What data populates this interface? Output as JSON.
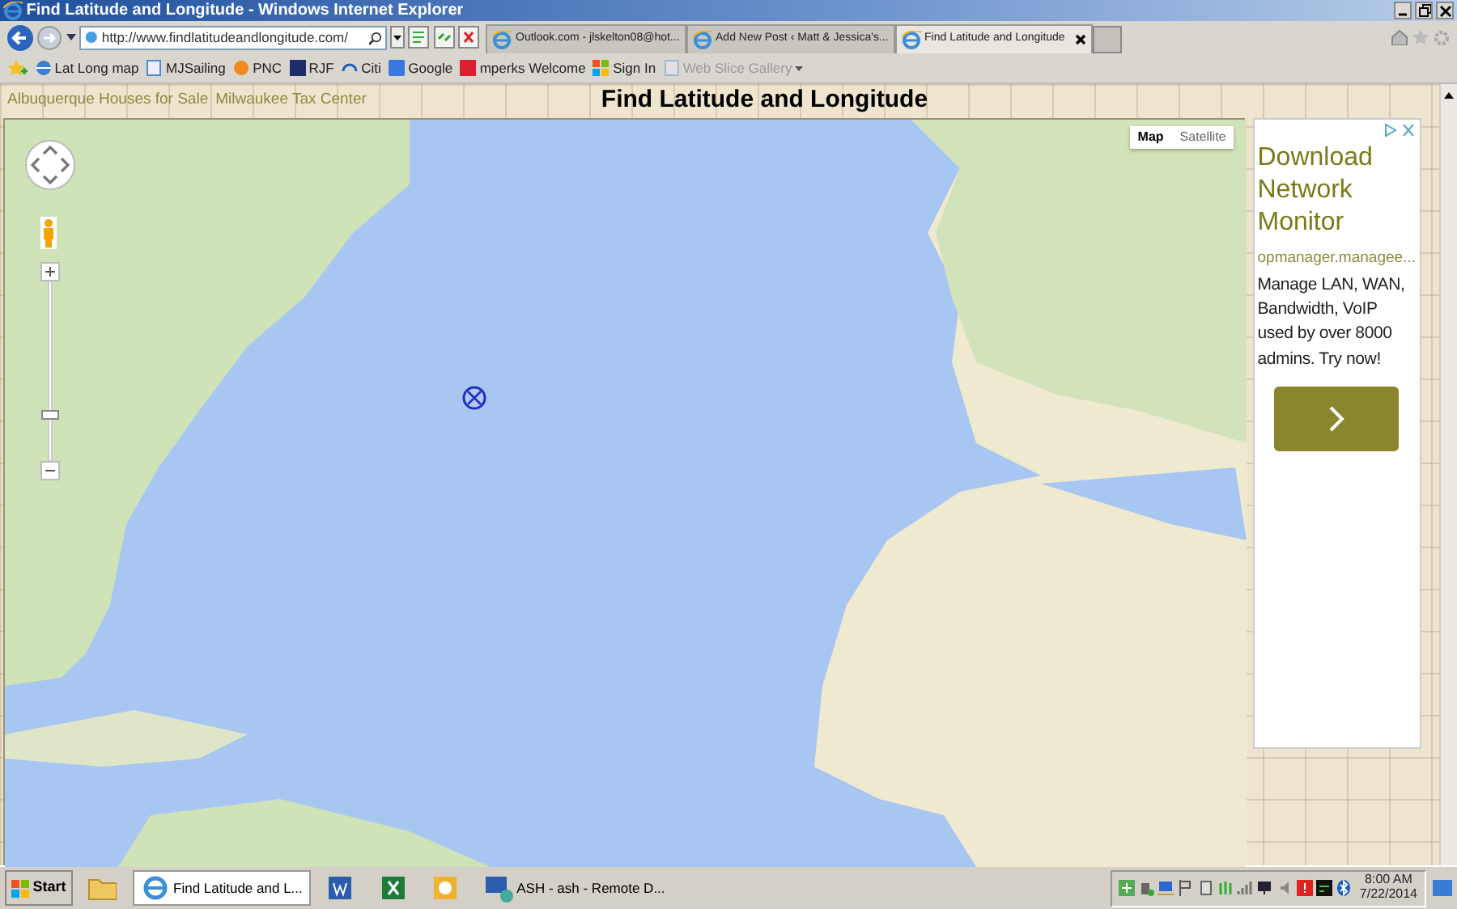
{
  "window": {
    "title": "Find Latitude and Longitude - Windows Internet Explorer"
  },
  "address_bar": {
    "url": "http://www.findlatitudeandlongitude.com/"
  },
  "tabs": [
    {
      "label": "Outlook.com - jlskelton08@hot...",
      "selected": false
    },
    {
      "label": "Add New Post ‹ Matt & Jessica's...",
      "selected": false
    },
    {
      "label": "Find Latitude and Longitude",
      "selected": true
    }
  ],
  "favorites": [
    {
      "label": "Lat Long map",
      "kind": "globe",
      "disabled": false
    },
    {
      "label": "MJSailing",
      "kind": "page",
      "disabled": false
    },
    {
      "label": "PNC",
      "kind": "orange",
      "disabled": false
    },
    {
      "label": "RJF",
      "kind": "navy",
      "disabled": false
    },
    {
      "label": "Citi",
      "kind": "citi",
      "disabled": false
    },
    {
      "label": "Google",
      "kind": "blue",
      "disabled": false
    },
    {
      "label": "mperks Welcome",
      "kind": "red",
      "disabled": false
    },
    {
      "label": "Sign In",
      "kind": "windows",
      "disabled": false
    },
    {
      "label": "Web Slice Gallery",
      "kind": "page",
      "disabled": true
    }
  ],
  "page": {
    "links": [
      "Albuquerque Houses for Sale",
      "Milwaukee Tax Center"
    ],
    "heading": "Find Latitude and Longitude"
  },
  "map": {
    "map_types": [
      {
        "label": "Map",
        "selected": true
      },
      {
        "label": "Satellite",
        "selected": false
      }
    ]
  },
  "ad": {
    "headline": "Download Network Monitor",
    "domain": "opmanager.managee...",
    "body": "Manage LAN, WAN, Bandwidth, VoIP used by over 8000 admins. Try now!"
  },
  "taskbar": {
    "start": "Start",
    "items": [
      {
        "kind": "folder",
        "selected": false
      },
      {
        "kind": "ie",
        "label": "Find Latitude and L...",
        "selected": true
      },
      {
        "kind": "word",
        "selected": false
      },
      {
        "kind": "excel",
        "selected": false
      },
      {
        "kind": "outlook",
        "selected": false
      },
      {
        "kind": "remote",
        "label": "ASH - ash - Remote D...",
        "selected": false
      }
    ],
    "clock": {
      "time": "8:00 AM",
      "date": "7/22/2014"
    }
  }
}
